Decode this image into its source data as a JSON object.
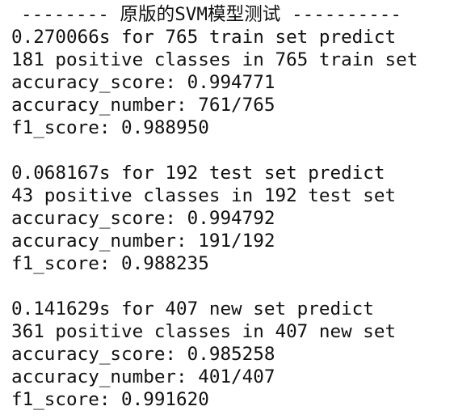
{
  "header": {
    "text": "-------- 原版的SVM模型测试 ----------"
  },
  "results": [
    {
      "lines": [
        "0.270066s for 765 train set predict",
        "181 positive classes in 765 train set",
        "accuracy_score: 0.994771",
        "accuracy_number: 761/765",
        "f1_score: 0.988950"
      ]
    },
    {
      "lines": [
        "0.068167s for 192 test set predict",
        "43 positive classes in 192 test set",
        "accuracy_score: 0.994792",
        "accuracy_number: 191/192",
        "f1_score: 0.988235"
      ]
    },
    {
      "lines": [
        "0.141629s for 407 new set predict",
        "361 positive classes in 407 new set",
        "accuracy_score: 0.985258",
        "accuracy_number: 401/407",
        "f1_score: 0.991620"
      ]
    }
  ]
}
